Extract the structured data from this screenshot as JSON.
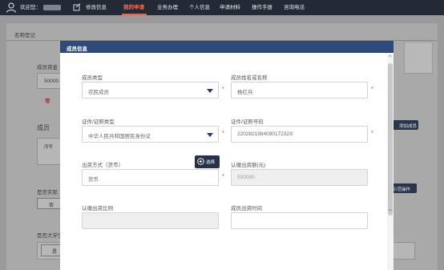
{
  "topbar": {
    "welcome": "欢迎您：",
    "edit_info": "修改信息",
    "nav": [
      "我的申请",
      "业务办理",
      "个人信息",
      "申请材料",
      "操作手册",
      "咨询电话"
    ]
  },
  "background": {
    "page_title": "名称登记",
    "capital_label": "成员资金",
    "capital_value": "50000",
    "capital_note": "零",
    "members_label": "成员",
    "member_col": "序号",
    "add_member": "添加成员",
    "actual_label": "是否实际",
    "actual_btn": "否",
    "guide_btn": "示范操作",
    "student_label": "是否大学生创业",
    "student_no": "是",
    "student_yes": "✔否"
  },
  "modal": {
    "title": "成员信息",
    "member_type_label": "成员类型",
    "member_type_value": "农民成员",
    "member_name_label": "成员姓名或名称",
    "member_name_value": "杨红兵",
    "cert_type_label": "证件/证照类型",
    "cert_type_value": "中华人民共和国居民身份证",
    "cert_no_label": "证件/证照号码",
    "cert_no_value": "220282198409017232X",
    "contribution_label": "出资方式（货币）",
    "choose_btn": "选择",
    "contribution_value": "货币",
    "subscribed_label": "认缴出资额(元)",
    "subscribed_value": "500000",
    "ratio_label": "认缴出资比例",
    "time_label": "成员出资时间"
  }
}
